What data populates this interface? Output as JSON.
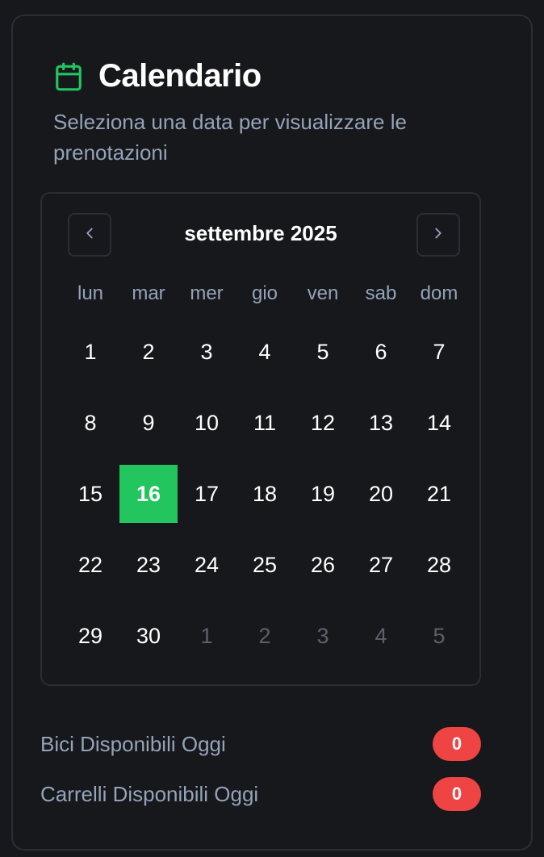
{
  "card": {
    "title": "Calendario",
    "subtitle": "Seleziona una data per visualizzare le prenotazioni",
    "icon": "calendar-icon",
    "accent_color": "#22c55e"
  },
  "calendar": {
    "month_label": "settembre 2025",
    "prev_icon": "chevron-left-icon",
    "next_icon": "chevron-right-icon",
    "weekdays": [
      "lun",
      "mar",
      "mer",
      "gio",
      "ven",
      "sab",
      "dom"
    ],
    "days": [
      {
        "label": "1",
        "outside": false
      },
      {
        "label": "2",
        "outside": false
      },
      {
        "label": "3",
        "outside": false
      },
      {
        "label": "4",
        "outside": false
      },
      {
        "label": "5",
        "outside": false
      },
      {
        "label": "6",
        "outside": false
      },
      {
        "label": "7",
        "outside": false
      },
      {
        "label": "8",
        "outside": false
      },
      {
        "label": "9",
        "outside": false
      },
      {
        "label": "10",
        "outside": false
      },
      {
        "label": "11",
        "outside": false
      },
      {
        "label": "12",
        "outside": false
      },
      {
        "label": "13",
        "outside": false
      },
      {
        "label": "14",
        "outside": false
      },
      {
        "label": "15",
        "outside": false
      },
      {
        "label": "16",
        "outside": false,
        "selected": true
      },
      {
        "label": "17",
        "outside": false
      },
      {
        "label": "18",
        "outside": false
      },
      {
        "label": "19",
        "outside": false
      },
      {
        "label": "20",
        "outside": false
      },
      {
        "label": "21",
        "outside": false
      },
      {
        "label": "22",
        "outside": false
      },
      {
        "label": "23",
        "outside": false
      },
      {
        "label": "24",
        "outside": false
      },
      {
        "label": "25",
        "outside": false
      },
      {
        "label": "26",
        "outside": false
      },
      {
        "label": "27",
        "outside": false
      },
      {
        "label": "28",
        "outside": false
      },
      {
        "label": "29",
        "outside": false
      },
      {
        "label": "30",
        "outside": false
      },
      {
        "label": "1",
        "outside": true
      },
      {
        "label": "2",
        "outside": true
      },
      {
        "label": "3",
        "outside": true
      },
      {
        "label": "4",
        "outside": true
      },
      {
        "label": "5",
        "outside": true
      }
    ]
  },
  "stats": [
    {
      "label": "Bici Disponibili Oggi",
      "value": "0",
      "color": "#ef4444"
    },
    {
      "label": "Carrelli Disponibili Oggi",
      "value": "0",
      "color": "#ef4444"
    }
  ]
}
